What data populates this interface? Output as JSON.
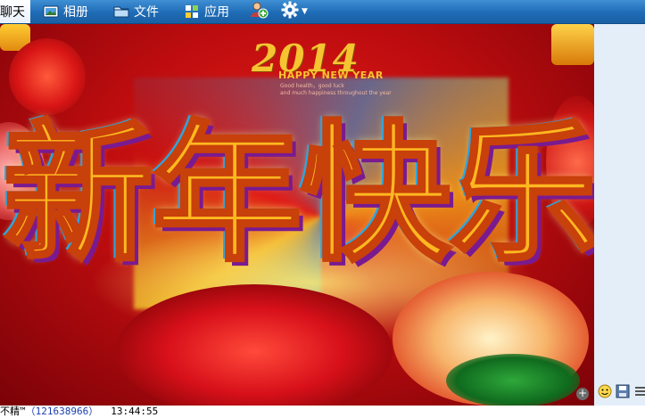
{
  "toolbar": {
    "tabs": [
      {
        "label": "聊天",
        "icon": "chat-icon"
      },
      {
        "label": "相册",
        "icon": "photo-album-icon"
      },
      {
        "label": "文件",
        "icon": "folder-icon"
      },
      {
        "label": "应用",
        "icon": "apps-grid-icon"
      }
    ],
    "extra_icons": [
      "add-friend-icon",
      "gear-icon",
      "chevron-down-icon"
    ],
    "accent_color": "#1f6cb6"
  },
  "banner": {
    "year": "2014",
    "title": "HAPPY NEW YEAR",
    "subtitle_line1": "Good health，good luck",
    "subtitle_line2": "and much happiness throughout the year",
    "big_chars": [
      "新",
      "年",
      "快",
      "乐"
    ]
  },
  "side_tools": [
    "emoji-icon",
    "save-icon",
    "more-icon"
  ],
  "message": {
    "sender": "不精™",
    "qq_id": "（121638966）",
    "time": "13:44:55"
  }
}
